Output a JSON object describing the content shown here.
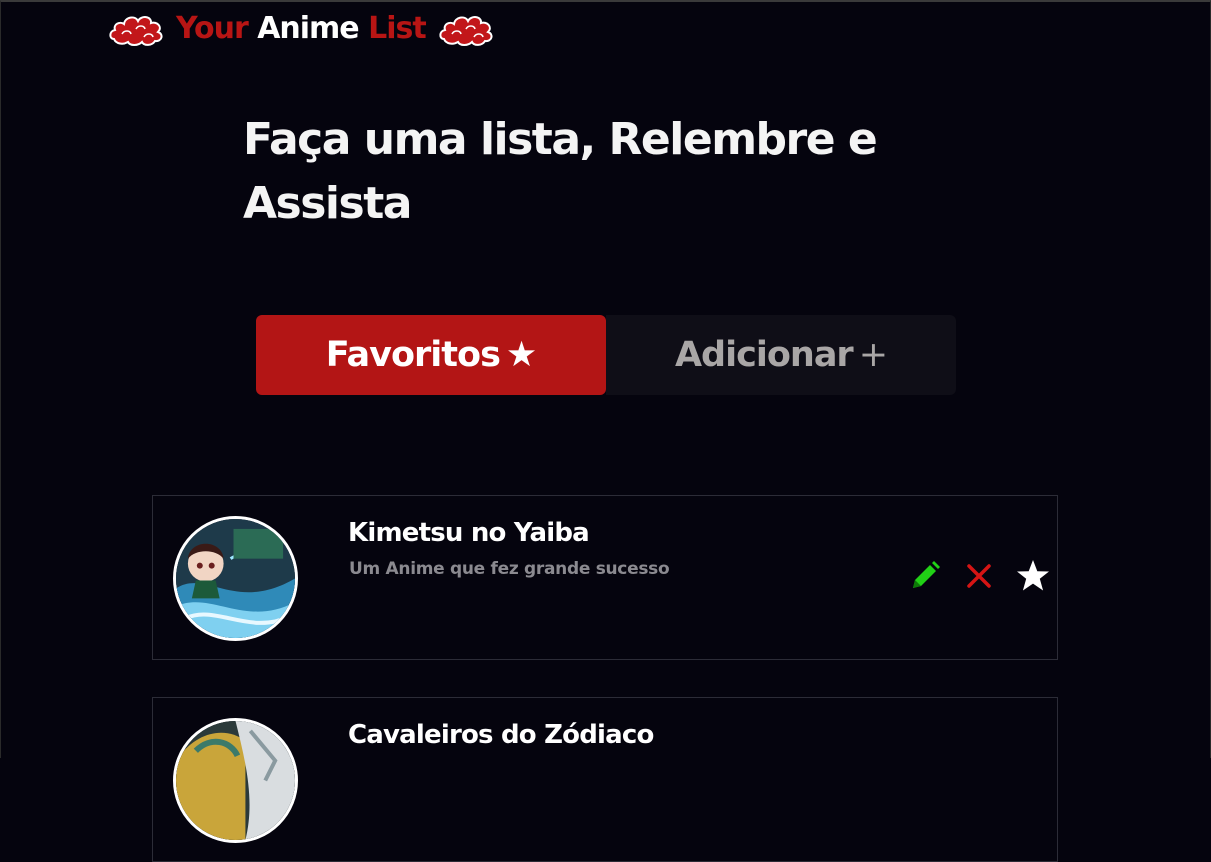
{
  "header": {
    "logo_your": "Your",
    "logo_anime": "Anime",
    "logo_list": "List"
  },
  "hero": {
    "heading": "Faça uma lista, Relembre e Assista"
  },
  "tabs": [
    {
      "label": "Favoritos",
      "glyph": "★",
      "active": true
    },
    {
      "label": "Adicionar",
      "glyph": "+",
      "active": false
    }
  ],
  "animes": [
    {
      "title": "Kimetsu no Yaiba",
      "description": "Um Anime que fez grande sucesso",
      "actions": [
        "pencil-icon",
        "close-icon",
        "star-icon"
      ]
    },
    {
      "title": "Cavaleiros do Zódiaco",
      "description": "",
      "actions": []
    }
  ],
  "colors": {
    "background": "#05040e",
    "brand_red": "#b31515",
    "edit_green": "#21d116",
    "delete_red": "#d61414",
    "muted_text": "#8b8a90",
    "inactive_tab_bg": "#0f0e17"
  }
}
